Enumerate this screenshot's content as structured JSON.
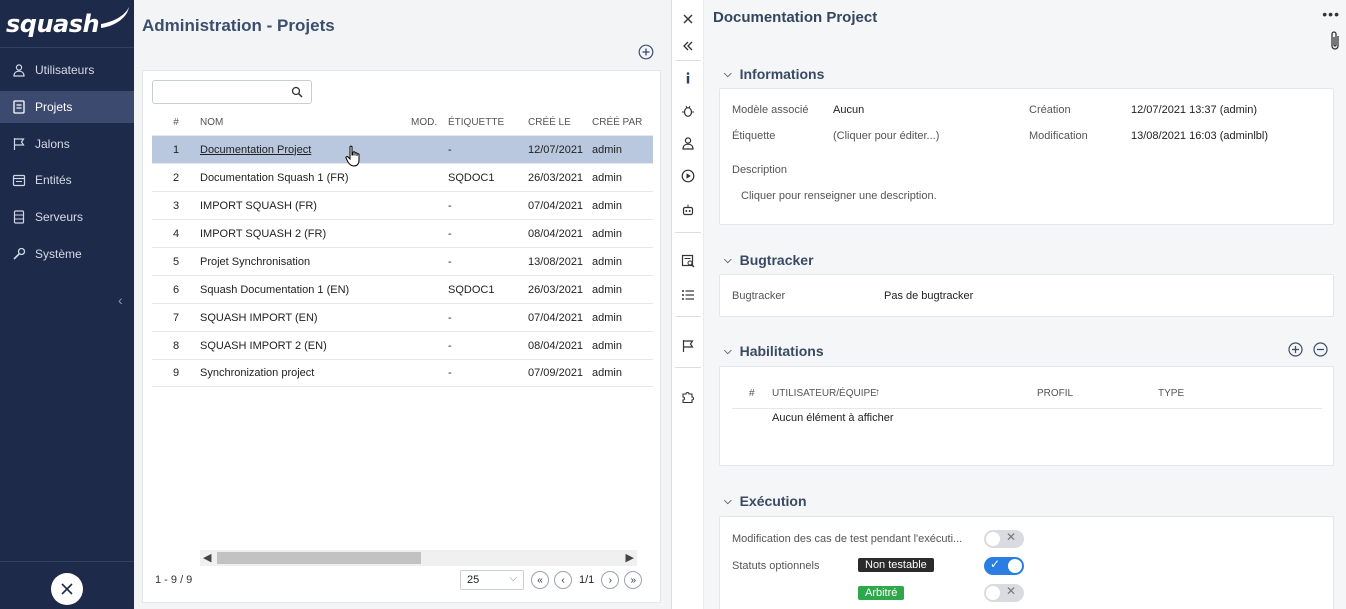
{
  "app": {
    "logo_text": "squash"
  },
  "sidebar": {
    "items": [
      {
        "label": "Utilisateurs",
        "icon": "user-icon",
        "active": false
      },
      {
        "label": "Projets",
        "icon": "projects-icon",
        "active": true
      },
      {
        "label": "Jalons",
        "icon": "flag-icon",
        "active": false
      },
      {
        "label": "Entités",
        "icon": "calendar-icon",
        "active": false
      },
      {
        "label": "Serveurs",
        "icon": "server-icon",
        "active": false
      },
      {
        "label": "Système",
        "icon": "wrench-icon",
        "active": false
      }
    ],
    "collapse_glyph": "‹"
  },
  "main": {
    "title": "Administration - Projets",
    "search": {
      "value": "",
      "placeholder": ""
    },
    "columns": [
      "#",
      "NOM",
      "MOD.",
      "ÉTIQUETTE",
      "CRÉÉ LE",
      "CRÉÉ PAR"
    ],
    "rows": [
      {
        "num": "1",
        "nom": "Documentation Project",
        "mod": "",
        "etiquette": "-",
        "cree_le": "12/07/2021",
        "cree_par": "admin",
        "selected": true
      },
      {
        "num": "2",
        "nom": "Documentation Squash 1 (FR)",
        "mod": "",
        "etiquette": "SQDOC1",
        "cree_le": "26/03/2021",
        "cree_par": "admin",
        "selected": false
      },
      {
        "num": "3",
        "nom": "IMPORT SQUASH (FR)",
        "mod": "",
        "etiquette": "-",
        "cree_le": "07/04/2021",
        "cree_par": "admin",
        "selected": false
      },
      {
        "num": "4",
        "nom": "IMPORT SQUASH 2 (FR)",
        "mod": "",
        "etiquette": "-",
        "cree_le": "08/04/2021",
        "cree_par": "admin",
        "selected": false
      },
      {
        "num": "5",
        "nom": "Projet Synchronisation",
        "mod": "",
        "etiquette": "-",
        "cree_le": "13/08/2021",
        "cree_par": "admin",
        "selected": false
      },
      {
        "num": "6",
        "nom": "Squash Documentation 1 (EN)",
        "mod": "",
        "etiquette": "SQDOC1",
        "cree_le": "26/03/2021",
        "cree_par": "admin",
        "selected": false
      },
      {
        "num": "7",
        "nom": "SQUASH IMPORT (EN)",
        "mod": "",
        "etiquette": "-",
        "cree_le": "07/04/2021",
        "cree_par": "admin",
        "selected": false
      },
      {
        "num": "8",
        "nom": "SQUASH IMPORT 2 (EN)",
        "mod": "",
        "etiquette": "-",
        "cree_le": "08/04/2021",
        "cree_par": "admin",
        "selected": false
      },
      {
        "num": "9",
        "nom": "Synchronization project",
        "mod": "",
        "etiquette": "-",
        "cree_le": "07/09/2021",
        "cree_par": "admin",
        "selected": false
      }
    ],
    "footer": {
      "count": "1 - 9 / 9",
      "page_size": "25",
      "page_info": "1/1"
    }
  },
  "detail": {
    "title": "Documentation Project",
    "informations": {
      "title": "Informations",
      "modele_label": "Modèle associé",
      "modele_value": "Aucun",
      "etiquette_label": "Étiquette",
      "etiquette_value": "(Cliquer pour éditer...)",
      "creation_label": "Création",
      "creation_value": "12/07/2021 13:37 (admin)",
      "modification_label": "Modification",
      "modification_value": "13/08/2021 16:03 (adminlbl)",
      "description_label": "Description",
      "description_value": "Cliquer pour renseigner une description."
    },
    "bugtracker": {
      "title": "Bugtracker",
      "label": "Bugtracker",
      "value": "Pas de bugtracker"
    },
    "habilitations": {
      "title": "Habilitations",
      "columns": [
        "#",
        "UTILISATEUR/ÉQUIPE",
        "PROFIL",
        "TYPE"
      ],
      "empty": "Aucun élément à afficher"
    },
    "execution": {
      "title": "Exécution",
      "modif_label": "Modification des cas de test pendant l'exécuti...",
      "modif_enabled": false,
      "statuts_label": "Statuts optionnels",
      "statuses": [
        {
          "label": "Non testable",
          "color": "#2b2b2b",
          "enabled": true
        },
        {
          "label": "Arbitré",
          "color": "#2ea84a",
          "enabled": false
        }
      ]
    }
  },
  "colors": {
    "sidebar_bg": "#1e2a4a",
    "selected_row": "#b9c8de",
    "accent": "#2a7de1"
  }
}
